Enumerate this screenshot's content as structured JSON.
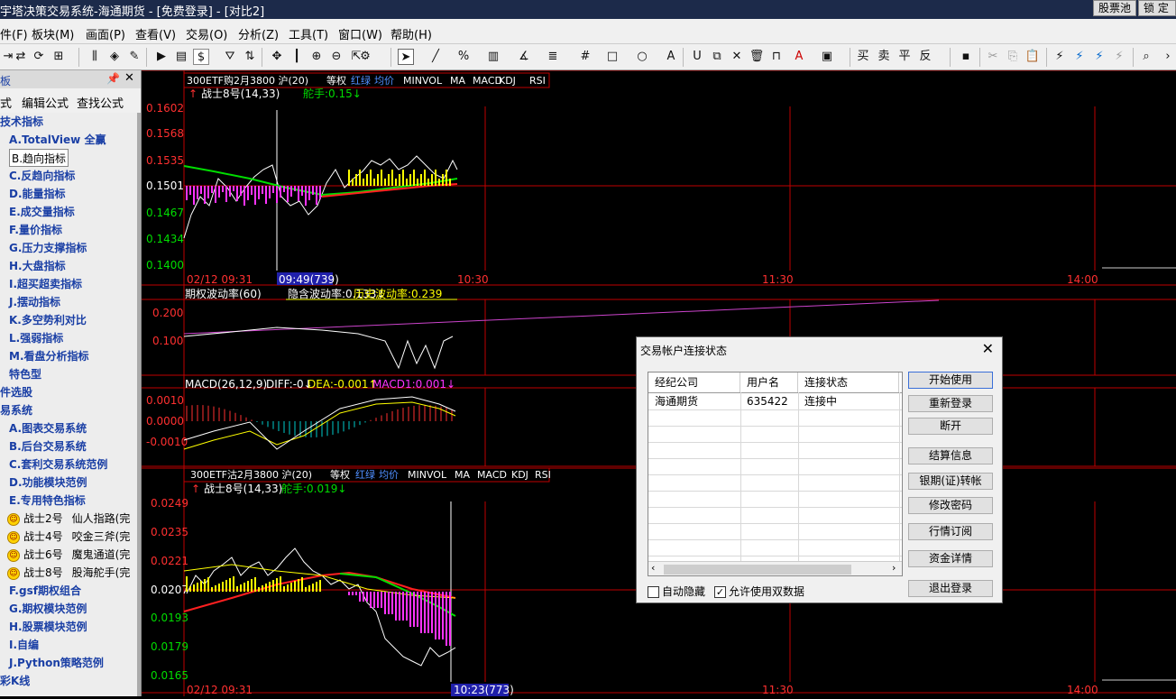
{
  "titlebar": {
    "title": "宇塔决策交易系统-海通期货 - [免费登录] - [对比2]",
    "btn_stock_pool": "股票池",
    "btn_lock": "锁 定"
  },
  "menu": [
    "件(F)",
    "板块(M)",
    "画面(P)",
    "查看(V)",
    "交易(O)",
    "分析(Z)",
    "工具(T)",
    "窗口(W)",
    "帮助(H)"
  ],
  "sidebar": {
    "tabs": [
      "式",
      "编辑公式",
      "查找公式"
    ],
    "tree": [
      {
        "label": "技术指标",
        "level": 0
      },
      {
        "label": "A.TotalView 全赢",
        "level": 1
      },
      {
        "label": "B.趋向指标",
        "level": 1,
        "selected": true
      },
      {
        "label": "C.反趋向指标",
        "level": 1
      },
      {
        "label": "D.能量指标",
        "level": 1
      },
      {
        "label": "E.成交量指标",
        "level": 1
      },
      {
        "label": "F.量价指标",
        "level": 1
      },
      {
        "label": "G.压力支撑指标",
        "level": 1
      },
      {
        "label": "H.大盘指标",
        "level": 1
      },
      {
        "label": "I.超买超卖指标",
        "level": 1
      },
      {
        "label": "J.摆动指标",
        "level": 1
      },
      {
        "label": "K.多空势利对比",
        "level": 1
      },
      {
        "label": "L.强弱指标",
        "level": 1
      },
      {
        "label": "M.看盘分析指标",
        "level": 1
      },
      {
        "label": "特色型",
        "level": 1
      },
      {
        "label": "件选股",
        "level": 0
      },
      {
        "label": "易系统",
        "level": 0
      },
      {
        "label": "A.图表交易系统",
        "level": 1
      },
      {
        "label": "B.后台交易系统",
        "level": 1
      },
      {
        "label": "C.套利交易系统范例",
        "level": 1
      },
      {
        "label": "D.功能模块范例",
        "level": 1
      },
      {
        "label": "E.专用特色指标",
        "level": 1
      },
      {
        "label": "战士2号",
        "desc": "仙人指路(完",
        "level": 2
      },
      {
        "label": "战士4号",
        "desc": "咬金三斧(完",
        "level": 2
      },
      {
        "label": "战士6号",
        "desc": "魔鬼通道(完",
        "level": 2
      },
      {
        "label": "战士8号",
        "desc": "股海舵手(完",
        "level": 2
      },
      {
        "label": "F.gsf期权组合",
        "level": 1
      },
      {
        "label": "G.期权模块范例",
        "level": 1
      },
      {
        "label": "H.股票模块范例",
        "level": 1
      },
      {
        "label": "I.自编",
        "level": 1
      },
      {
        "label": "J.Python策略范例",
        "level": 1
      },
      {
        "label": "彩K线",
        "level": 0
      }
    ]
  },
  "chart": {
    "top_panel": {
      "contract": "300ETF购2月3800 沪(20)",
      "buttons": [
        "等权",
        "红绿",
        "均价",
        "MINVOL",
        "MA",
        "MACD",
        "KDJ",
        "RSI"
      ],
      "indicator": "战士8号(14,33)",
      "helm": "舵手:0.15↓",
      "y_ticks": [
        "0.1602",
        "0.1568",
        "0.1535",
        "0.1501",
        "0.1467",
        "0.1434",
        "0.1400"
      ],
      "x_start": "02/12 09:31",
      "x_cursor": "09:49(739)",
      "x_ticks": [
        "10:30",
        "11:30",
        "14:00"
      ]
    },
    "vol_panel": {
      "title": "期权波动率(60)",
      "implied": "隐含波动率:0.133↓",
      "historical": "历史波动率:0.239",
      "y_ticks": [
        "0.200",
        "0.100"
      ]
    },
    "macd_panel": {
      "title": "MACD(26,12,9)",
      "diff": "DIFF:-0↓",
      "dea": "DEA:-0.001↑",
      "macd": "MACD1:0.001↓",
      "y_ticks": [
        "0.0010",
        "0.0000",
        "-0.0010"
      ]
    },
    "bottom_panel": {
      "contract": "300ETF沽2月3800 沪(20)",
      "buttons": [
        "等权",
        "红绿",
        "均价",
        "MINVOL",
        "MA",
        "MACD",
        "KDJ",
        "RSI"
      ],
      "indicator": "战士8号(14,33)",
      "helm": "舵手:0.019↓",
      "y_ticks": [
        "0.0249",
        "0.0235",
        "0.0221",
        "0.0207",
        "0.0193",
        "0.0179",
        "0.0165"
      ],
      "x_start": "02/12 09:31",
      "x_cursor": "10:23(773)",
      "x_ticks": [
        "11:30",
        "14:00"
      ]
    },
    "colors": {
      "grid": "#c00000",
      "axis_up": "#ff3030",
      "axis_down": "#00dd00",
      "price": "#ffffff",
      "ma_fast": "#ffff00",
      "ma_slow_red": "#ff2020",
      "ma_green": "#00dd00",
      "bar_up": "#ffff00",
      "bar_down": "#ff33ff",
      "vol_line": "#cc44cc"
    }
  },
  "dialog": {
    "title": "交易帐户连接状态",
    "columns": [
      "经纪公司",
      "用户名",
      "连接状态"
    ],
    "rows": [
      {
        "broker": "海通期货",
        "user": "635422",
        "status": "连接中"
      }
    ],
    "buttons": [
      "开始使用",
      "重新登录",
      "断开",
      "结算信息",
      "银期(证)转帐",
      "修改密码",
      "行情订阅",
      "资金详情",
      "退出登录"
    ],
    "checkbox_autohide": "自动隐藏",
    "checkbox_dual": "允许使用双数据",
    "checkbox_autohide_checked": false,
    "checkbox_dual_checked": true
  }
}
